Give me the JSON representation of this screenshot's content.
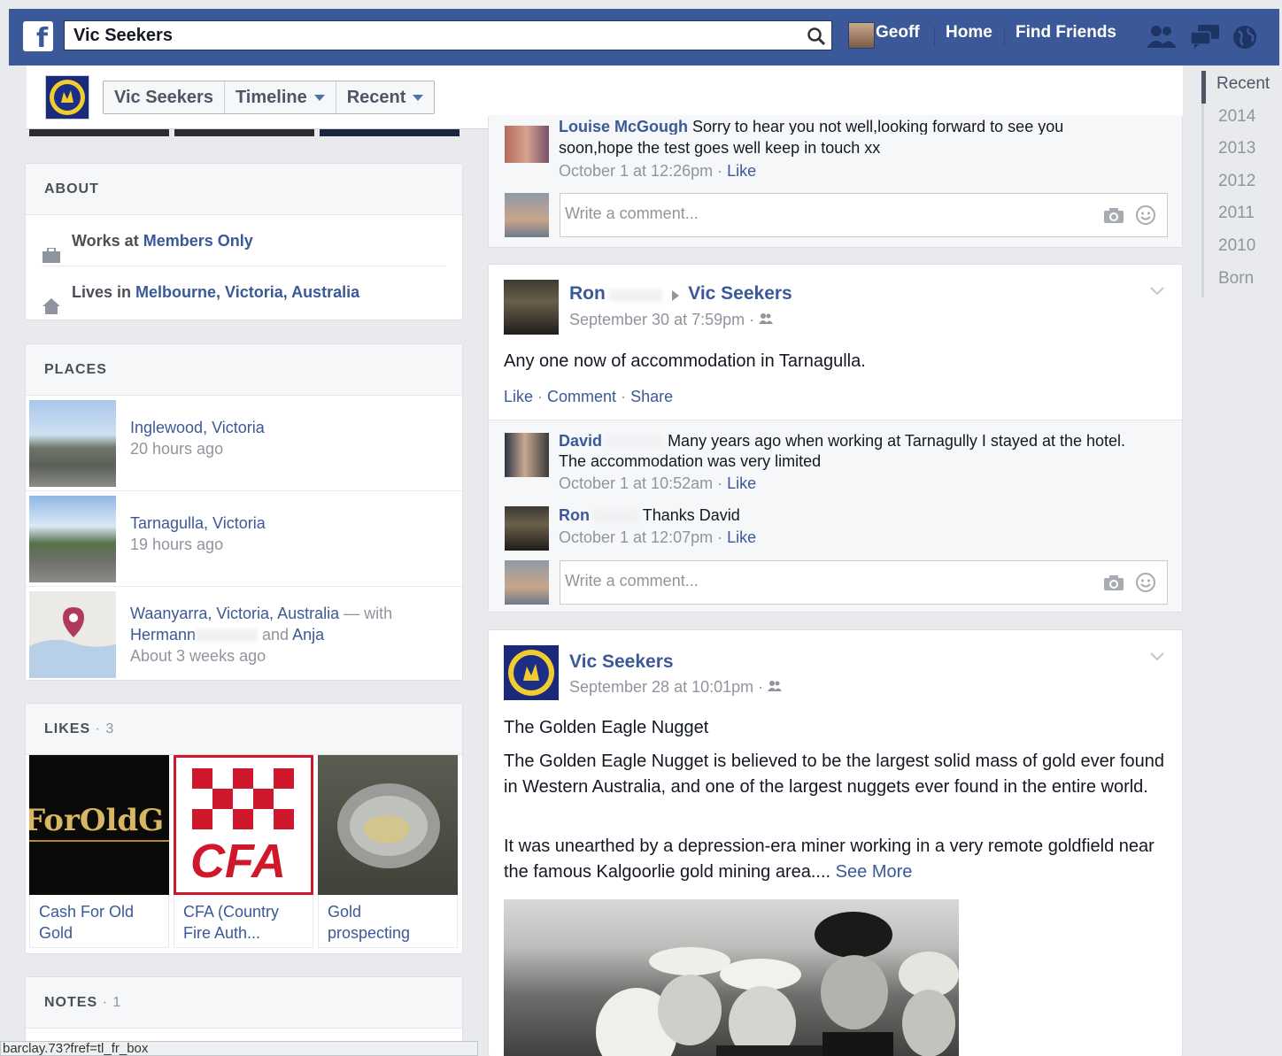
{
  "topbar": {
    "logo": "f",
    "search_value": "Vic Seekers",
    "user_name": "Geoff",
    "nav_home": "Home",
    "nav_find_friends": "Find Friends",
    "icons": [
      "search-icon",
      "friend-requests-icon",
      "messages-icon",
      "notifications-globe-icon"
    ]
  },
  "cover": {
    "page_name_button": "Vic Seekers",
    "timeline_button": "Timeline",
    "recent_button": "Recent"
  },
  "about": {
    "header": "ABOUT",
    "works_prefix": "Works at ",
    "works_link": "Members Only",
    "lives_prefix": "Lives in ",
    "lives_link": "Melbourne, Victoria, Australia"
  },
  "places": {
    "header": "PLACES",
    "items": [
      {
        "name": "Inglewood, Victoria",
        "time": "20 hours ago"
      },
      {
        "name": "Tarnagulla, Victoria",
        "time": "19 hours ago"
      },
      {
        "name": "Waanyarra, Victoria, Australia",
        "with": " — with",
        "friend1": "Hermann",
        "and": " and ",
        "friend2": "Anja",
        "time": "About 3 weeks ago"
      }
    ]
  },
  "likes": {
    "header": "LIKES",
    "count": " · 3",
    "items": [
      {
        "label": "Cash For Old Gold",
        "image_text": "ForOldG"
      },
      {
        "label": "CFA (Country Fire Auth...",
        "image_text": "CFA"
      },
      {
        "label": "Gold prospecting"
      }
    ]
  },
  "notes": {
    "header": "NOTES",
    "count": " · 1"
  },
  "feed": {
    "post0": {
      "comment_name": "Louise McGough",
      "comment_text_top": " Sorry to hear you not well,looking forward to see you",
      "comment_text": "soon,hope the test goes well keep in touch xx",
      "comment_time": "October 1 at 12:26pm",
      "comment_like": "Like",
      "write_placeholder": "Write a comment..."
    },
    "post1": {
      "author": "Ron",
      "target": "Vic Seekers",
      "time": "September 30 at 7:59pm",
      "text": "Any one now of accommodation in Tarnagulla.",
      "action_like": "Like",
      "action_comment": "Comment",
      "action_share": "Share",
      "comments": [
        {
          "name": "David",
          "text": "Many years ago when working at Tarnagully I stayed at the hotel.",
          "text2": "The accommodation was very limited",
          "time": "October 1 at 10:52am",
          "like": "Like"
        },
        {
          "name": "Ron",
          "text": "Thanks David",
          "time": "October 1 at 12:07pm",
          "like": "Like"
        }
      ],
      "write_placeholder": "Write a comment..."
    },
    "post2": {
      "author": "Vic Seekers",
      "time": "September 28 at 10:01pm",
      "title": "The Golden Eagle Nugget",
      "para1": "The Golden Eagle Nugget is believed to be the largest solid mass of gold ever found in Western Australia, and one of the largest nuggets ever found in the entire world.",
      "para2": "It was unearthed by a depression-era miner working in a very remote goldfield near the famous Kalgoorlie gold mining area....",
      "see_more": "See More"
    }
  },
  "timeline_nav": {
    "items": [
      "Recent",
      "2014",
      "2013",
      "2012",
      "2011",
      "2010",
      "Born"
    ]
  },
  "statusbar": {
    "url": "barclay.73?fref=tl_fr_box"
  },
  "colors": {
    "brand_blue": "#3b5998",
    "background": "#e9eaed",
    "meta_grey": "#90949c"
  }
}
